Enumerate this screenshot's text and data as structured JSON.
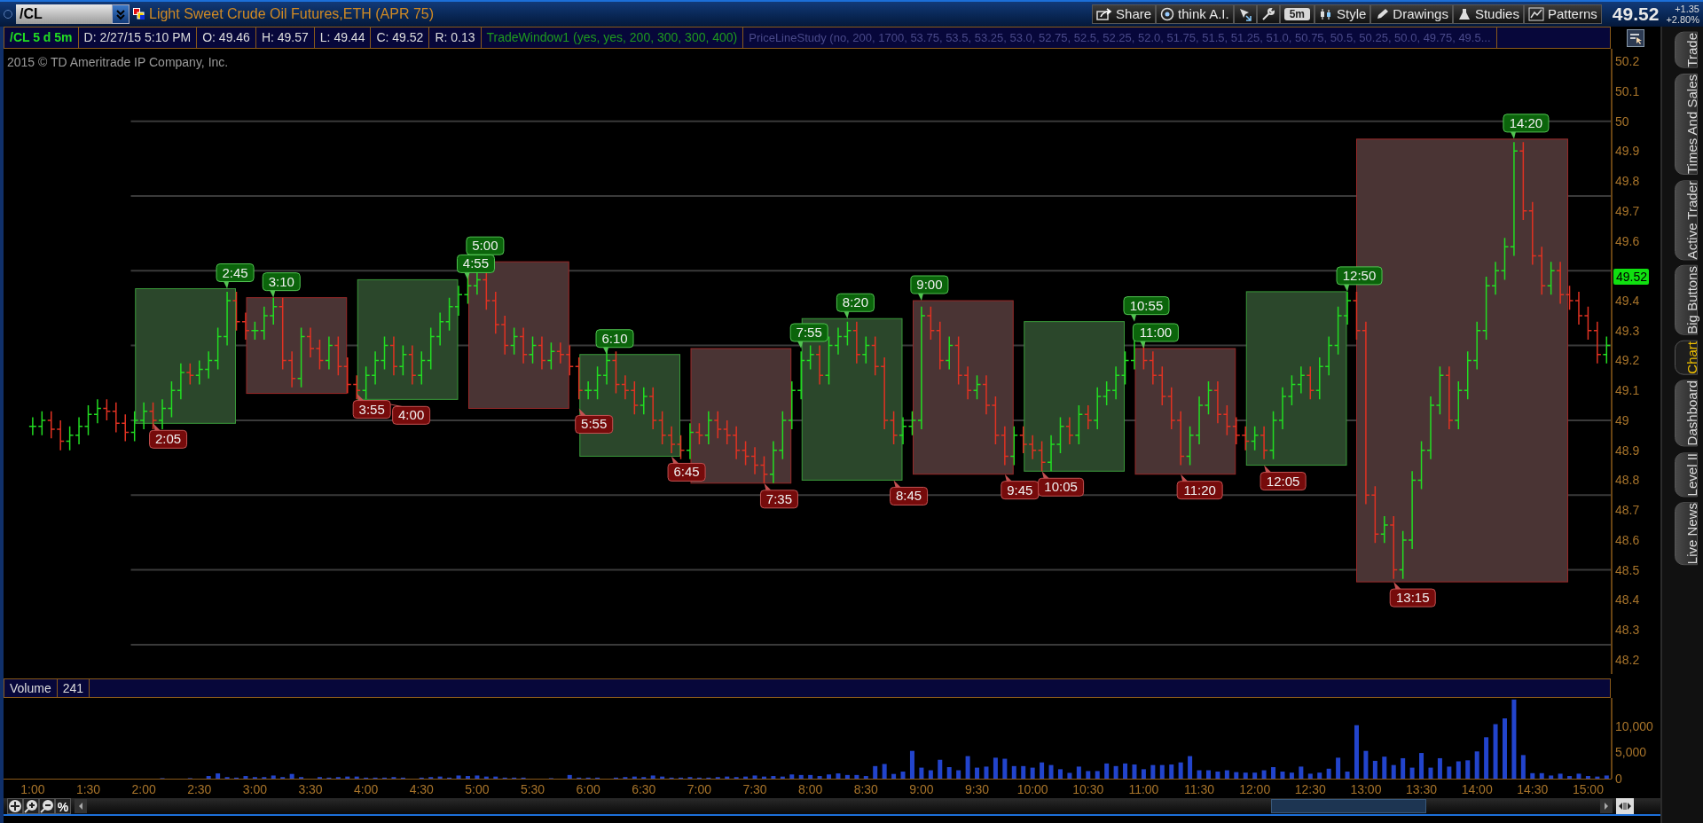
{
  "toolbar": {
    "symbol": "/CL",
    "title": "Light Sweet Crude Oil Futures,ETH (APR 75)",
    "buttons": [
      {
        "kind": "share",
        "label": "Share"
      },
      {
        "kind": "ai",
        "label": "think A.I."
      },
      {
        "kind": "cursor"
      },
      {
        "kind": "wrench"
      },
      {
        "kind": "aggregation",
        "label": "5m"
      },
      {
        "kind": "style",
        "label": "Style"
      },
      {
        "kind": "drawings",
        "label": "Drawings"
      },
      {
        "kind": "studies",
        "label": "Studies"
      },
      {
        "kind": "patterns",
        "label": "Patterns"
      }
    ],
    "last": "49.52",
    "change": "+1.35",
    "change_pct": "+2.80%"
  },
  "info_bar": [
    {
      "kind": "symbol",
      "text": "/CL 5 d 5m"
    },
    {
      "kind": "plain",
      "text": "D: 2/27/15 5:10 PM"
    },
    {
      "kind": "plain",
      "text": "O: 49.46"
    },
    {
      "kind": "plain",
      "text": "H: 49.57"
    },
    {
      "kind": "plain",
      "text": "L: 49.44"
    },
    {
      "kind": "plain",
      "text": "C: 49.52"
    },
    {
      "kind": "plain",
      "text": "R: 0.13"
    },
    {
      "kind": "study",
      "text": "TradeWindow1 (yes, yes, 200, 300, 300, 400)"
    },
    {
      "kind": "study_off",
      "text": "PriceLineStudy (no, 200, 1700, 53.75, 53.5, 53.25, 53.0, 52.75, 52.5, 52.25, 52.0, 51.75, 51.5, 51.25, 51.0, 50.75, 50.5, 50.25, 50.0, 49.75, 49.5..."
    }
  ],
  "copyright": "2015 © TD Ameritrade IP Company, Inc.",
  "trade_windows": [
    {
      "color": "#2b472b"
    },
    {
      "color": "#4a3434"
    },
    {
      "color": "#2b472b"
    },
    {
      "color": "#4a3434"
    },
    {
      "color": "#2b472b"
    },
    {
      "color": "#4a3434"
    },
    {
      "color": "#2b472b"
    },
    {
      "color": "#4a3434"
    },
    {
      "color": "#2b472b"
    },
    {
      "color": "#4a3434"
    },
    {
      "color": "#2b472b"
    },
    {
      "color": "#4a3434"
    }
  ],
  "callouts": [
    {
      "kind": "high",
      "text": "2:45"
    },
    {
      "kind": "low",
      "text": "2:05"
    },
    {
      "kind": "high",
      "text": "3:10"
    },
    {
      "kind": "low",
      "text": "4:00"
    },
    {
      "kind": "low",
      "text": "3:55"
    },
    {
      "kind": "high",
      "text": "5:00"
    },
    {
      "kind": "high",
      "text": "4:55"
    },
    {
      "kind": "low",
      "text": "5:55"
    },
    {
      "kind": "high",
      "text": "6:10"
    },
    {
      "kind": "low",
      "text": "6:45"
    },
    {
      "kind": "high",
      "text": "7:55"
    },
    {
      "kind": "low",
      "text": "7:35"
    },
    {
      "kind": "high",
      "text": "8:20"
    },
    {
      "kind": "low",
      "text": "8:45"
    },
    {
      "kind": "high",
      "text": "9:00"
    },
    {
      "kind": "low",
      "text": "9:45"
    },
    {
      "kind": "high",
      "text": "10:55"
    },
    {
      "kind": "low",
      "text": "10:05"
    },
    {
      "kind": "high",
      "text": "11:00"
    },
    {
      "kind": "low",
      "text": "11:20"
    },
    {
      "kind": "high",
      "text": "12:50"
    },
    {
      "kind": "low",
      "text": "12:05"
    },
    {
      "kind": "high",
      "text": "14:20"
    },
    {
      "kind": "low",
      "text": "13:15"
    }
  ],
  "price_axis": [
    {
      "kind": "tick",
      "text": "50.2"
    },
    {
      "kind": "tick",
      "text": "50.1"
    },
    {
      "kind": "tick",
      "text": "50"
    },
    {
      "kind": "tick",
      "text": "49.9"
    },
    {
      "kind": "tick",
      "text": "49.8"
    },
    {
      "kind": "tick",
      "text": "49.7"
    },
    {
      "kind": "tick",
      "text": "49.6"
    },
    {
      "kind": "last",
      "text": "49.52"
    },
    {
      "kind": "tick",
      "text": "49.4"
    },
    {
      "kind": "tick",
      "text": "49.3"
    },
    {
      "kind": "tick",
      "text": "49.2"
    },
    {
      "kind": "tick",
      "text": "49.1"
    },
    {
      "kind": "tick",
      "text": "49"
    },
    {
      "kind": "tick",
      "text": "48.9"
    },
    {
      "kind": "tick",
      "text": "48.8"
    },
    {
      "kind": "tick",
      "text": "48.7"
    },
    {
      "kind": "tick",
      "text": "48.6"
    },
    {
      "kind": "tick",
      "text": "48.5"
    },
    {
      "kind": "tick",
      "text": "48.4"
    },
    {
      "kind": "tick",
      "text": "48.3"
    },
    {
      "kind": "tick",
      "text": "48.2"
    }
  ],
  "volume_header": {
    "label": "Volume",
    "value": "241"
  },
  "volume_axis": [
    "10,000",
    "5,000",
    "0"
  ],
  "time_axis": [
    "1:00",
    "1:30",
    "2:00",
    "2:30",
    "3:00",
    "3:30",
    "4:00",
    "4:30",
    "5:00",
    "5:30",
    "6:00",
    "6:30",
    "7:00",
    "7:30",
    "8:00",
    "8:30",
    "9:00",
    "9:30",
    "10:00",
    "10:30",
    "11:00",
    "11:30",
    "12:00",
    "12:30",
    "13:00",
    "13:30",
    "14:00",
    "14:30",
    "15:00"
  ],
  "bottom_tools": [
    {
      "kind": "pan"
    },
    {
      "kind": "zoom_in"
    },
    {
      "kind": "zoom_out"
    },
    {
      "kind": "percent",
      "label": "%"
    }
  ],
  "side_tabs": [
    {
      "label": "Trade",
      "selected": false
    },
    {
      "label": "Times And Sales",
      "selected": false
    },
    {
      "label": "Active Trader",
      "selected": false
    },
    {
      "label": "Big Buttons",
      "selected": false
    },
    {
      "label": "Chart",
      "selected": true
    },
    {
      "label": "Dashboard",
      "selected": false
    },
    {
      "label": "Level II",
      "selected": false
    },
    {
      "label": "Live News",
      "selected": false
    }
  ]
}
